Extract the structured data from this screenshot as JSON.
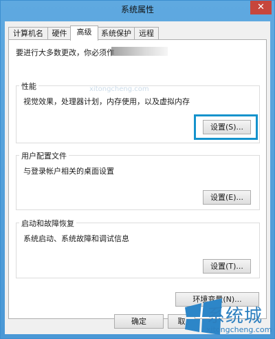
{
  "window": {
    "title": "系统属性",
    "close_glyph": "✕"
  },
  "tabs": [
    {
      "label": "计算机名",
      "active": false
    },
    {
      "label": "硬件",
      "active": false
    },
    {
      "label": "高级",
      "active": true
    },
    {
      "label": "系统保护",
      "active": false
    },
    {
      "label": "远程",
      "active": false
    }
  ],
  "notice": "要进行大多数更改，你必须作",
  "groups": {
    "performance": {
      "label": "性能",
      "desc": "视觉效果，处理器计划，内存使用，以及虚拟内存",
      "button": "设置(S)..."
    },
    "profile": {
      "label": "用户配置文件",
      "desc": "与登录帐户相关的桌面设置",
      "button": "设置(E)..."
    },
    "startup": {
      "label": "启动和故障恢复",
      "desc": "系统启动、系统故障和调试信息",
      "button": "设置(T)..."
    }
  },
  "env_button": "环境变量(N)...",
  "footer": {
    "ok": "确定",
    "cancel": "取"
  },
  "watermark": {
    "brand": "系统城",
    "url": "xitongcheng.com",
    "faint": "xitongcheng.com"
  },
  "colors": {
    "highlight": "#1492cc",
    "brand": "#2c7fbf"
  }
}
